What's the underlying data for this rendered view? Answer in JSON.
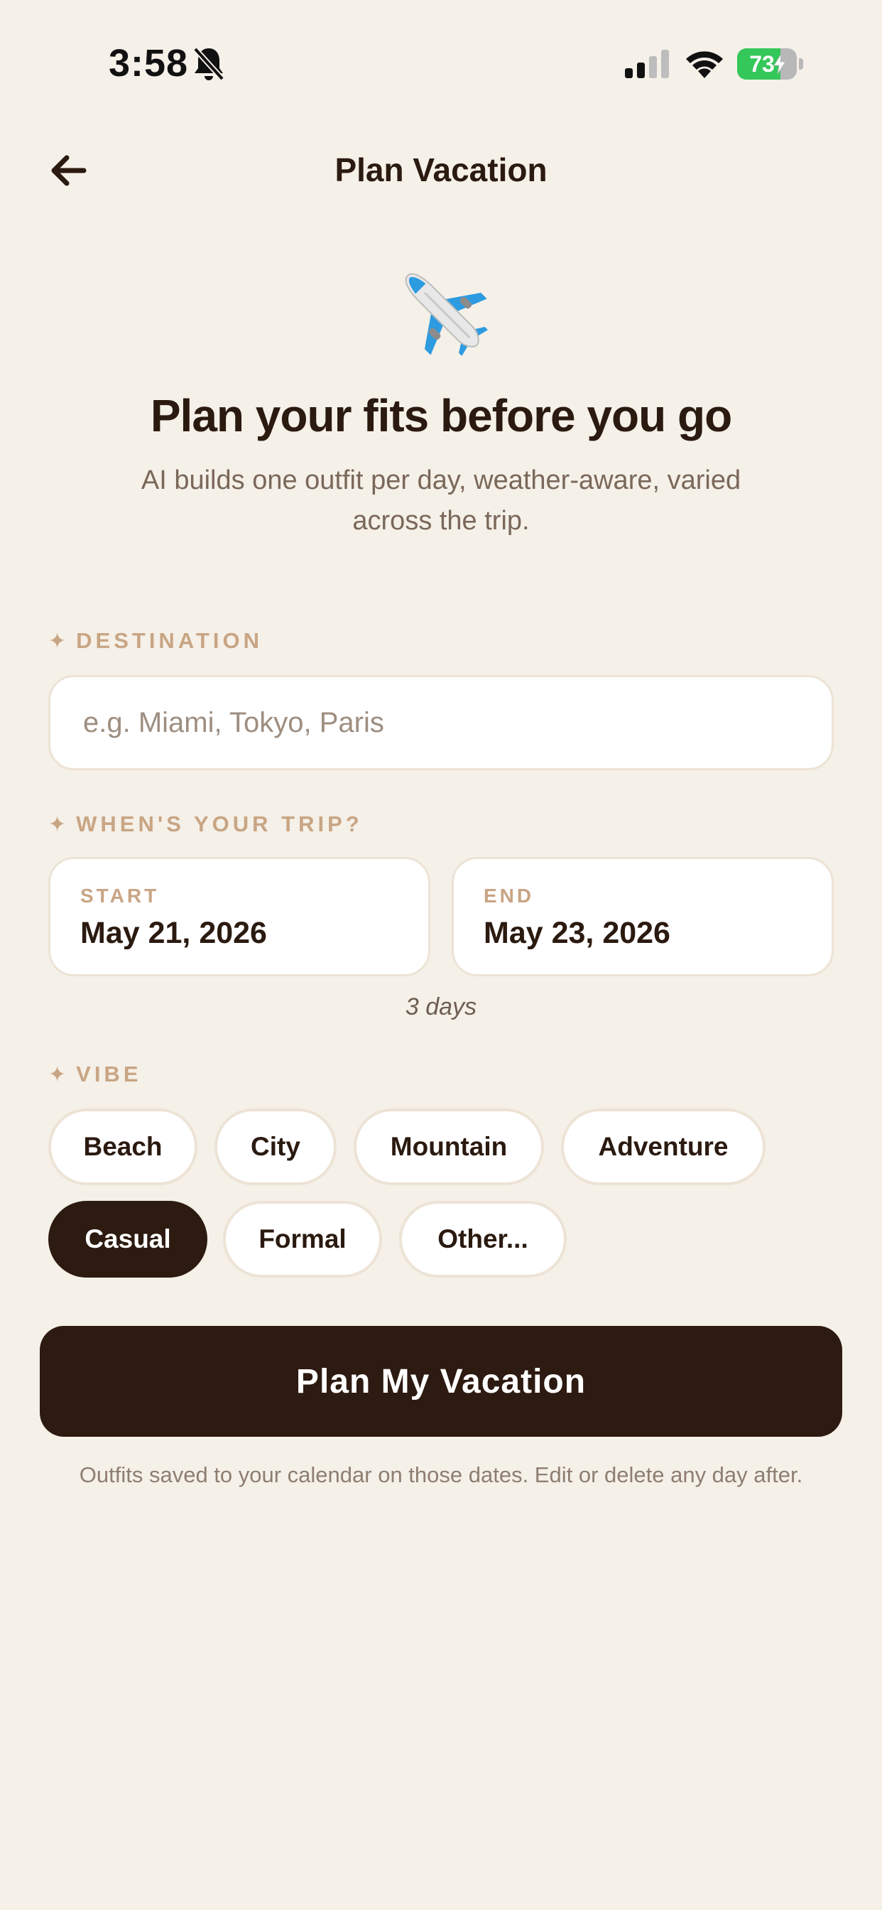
{
  "status_bar": {
    "time": "3:58",
    "battery_level": "73",
    "battery_fraction": 0.73,
    "icons": [
      "bell-slash-icon",
      "cellular-signal-icon",
      "wifi-icon",
      "battery-charging-icon"
    ]
  },
  "nav": {
    "title": "Plan Vacation",
    "back_icon": "arrow-left-icon"
  },
  "hero": {
    "icon": "airplane-icon",
    "title": "Plan your fits before you go",
    "subtitle": "AI builds one outfit per day, weather-aware, varied across the trip."
  },
  "destination": {
    "label": "DESTINATION",
    "placeholder": "e.g. Miami, Tokyo, Paris",
    "value": ""
  },
  "trip": {
    "label": "WHEN'S YOUR TRIP?",
    "start_label": "START",
    "start_value": "May 21, 2026",
    "end_label": "END",
    "end_value": "May 23, 2026",
    "duration": "3 days"
  },
  "vibe": {
    "label": "VIBE",
    "options": [
      "Beach",
      "City",
      "Mountain",
      "Adventure",
      "Casual",
      "Formal",
      "Other..."
    ],
    "selected": "Casual"
  },
  "actions": {
    "plan_button": "Plan My Vacation",
    "footer_note": "Outfits saved to your calendar on those dates. Edit or delete any day after."
  },
  "colors": {
    "background": "#F5F0E8",
    "primary_dark": "#2D1A10",
    "accent_label": "#C8A584",
    "battery_green": "#34C759"
  }
}
